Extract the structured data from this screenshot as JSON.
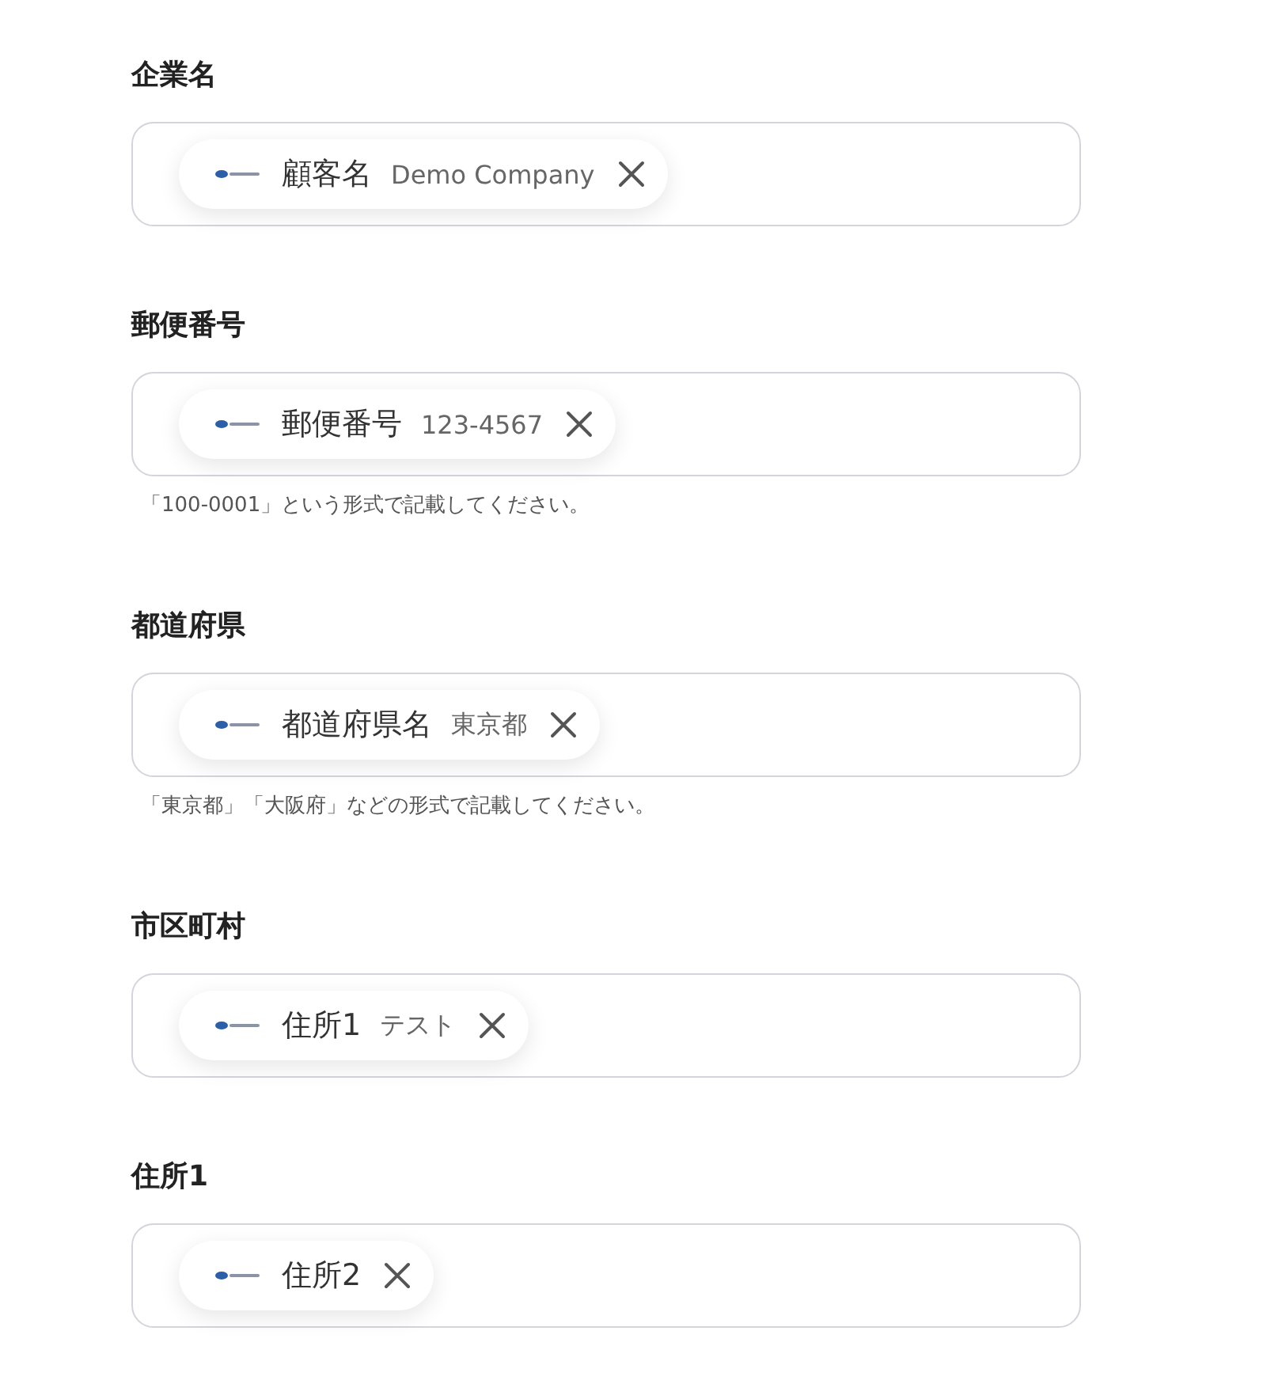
{
  "fields": [
    {
      "label": "企業名",
      "chip": {
        "name": "顧客名",
        "value": "Demo Company"
      }
    },
    {
      "label": "郵便番号",
      "chip": {
        "name": "郵便番号",
        "value": "123-4567"
      },
      "hint": "「100-0001」という形式で記載してください。"
    },
    {
      "label": "都道府県",
      "chip": {
        "name": "都道府県名",
        "value": "東京都"
      },
      "hint": "「東京都」「大阪府」などの形式で記載してください。"
    },
    {
      "label": "市区町村",
      "chip": {
        "name": "住所1",
        "value": "テスト"
      }
    },
    {
      "label": "住所1",
      "chip": {
        "name": "住所2"
      }
    }
  ]
}
